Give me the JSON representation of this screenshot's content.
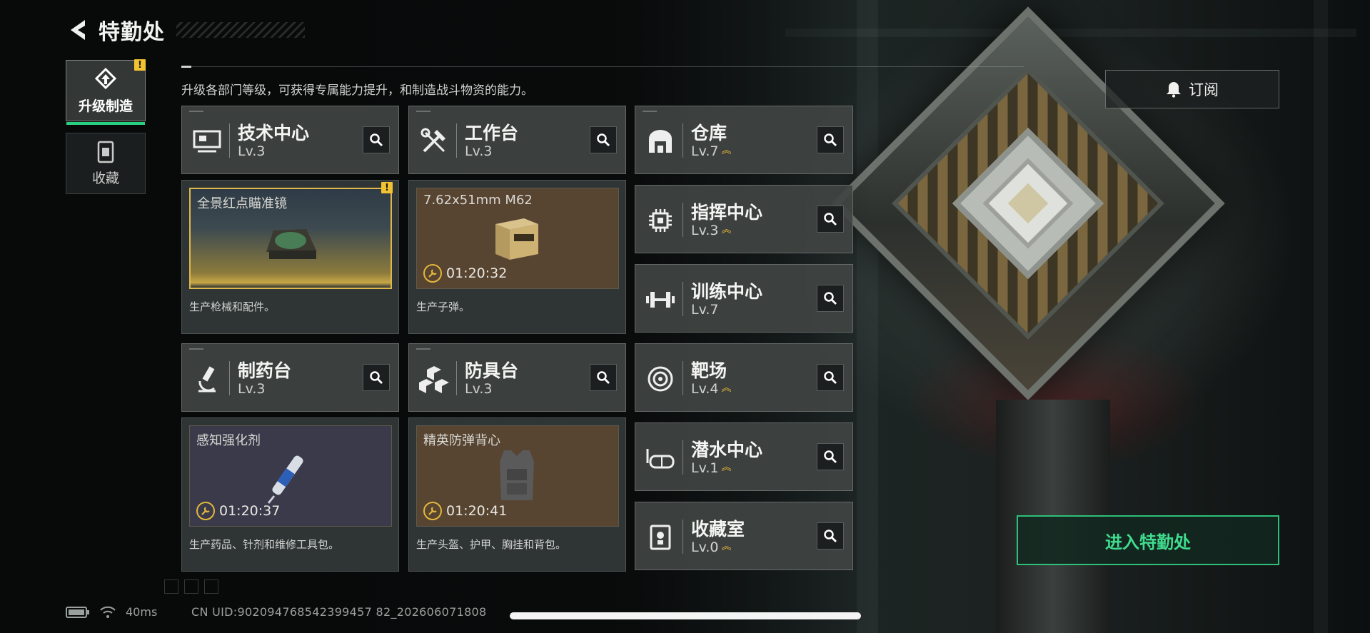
{
  "header": {
    "title": "特勤处"
  },
  "sidebar": {
    "tabs": [
      {
        "label": "升级制造",
        "active": true,
        "alert": "!"
      },
      {
        "label": "收藏",
        "active": false
      }
    ]
  },
  "subtitle": "升级各部门等级，可获得专属能力提升，和制造战斗物资的能力。",
  "production_departments": [
    {
      "name": "技术中心",
      "level": "Lv.3",
      "item": "全景红点瞄准镜",
      "timer": "",
      "desc": "生产枪械和配件。",
      "alert": "!"
    },
    {
      "name": "工作台",
      "level": "Lv.3",
      "item": "7.62x51mm M62",
      "timer": "01:20:32",
      "desc": "生产子弹。"
    },
    {
      "name": "制药台",
      "level": "Lv.3",
      "item": "感知强化剂",
      "timer": "01:20:37",
      "desc": "生产药品、针剂和维修工具包。"
    },
    {
      "name": "防具台",
      "level": "Lv.3",
      "item": "精英防弹背心",
      "timer": "01:20:41",
      "desc": "生产头盔、护甲、胸挂和背包。"
    }
  ],
  "facility_departments": [
    {
      "name": "仓库",
      "level": "Lv.7",
      "upgradable": true
    },
    {
      "name": "指挥中心",
      "level": "Lv.3",
      "upgradable": true
    },
    {
      "name": "训练中心",
      "level": "Lv.7",
      "upgradable": false
    },
    {
      "name": "靶场",
      "level": "Lv.4",
      "upgradable": true
    },
    {
      "name": "潜水中心",
      "level": "Lv.1",
      "upgradable": true
    },
    {
      "name": "收藏室",
      "level": "Lv.0",
      "upgradable": true
    }
  ],
  "buttons": {
    "subscribe": "订阅",
    "enter": "进入特勤处"
  },
  "status": {
    "ping": "40ms",
    "uid": "CN UID:902094768542399457 82_202606071808"
  },
  "colors": {
    "accent_green": "#2fbf7a",
    "upgrade_gold": "#e8b93a",
    "alert_yellow": "#f2c230"
  }
}
